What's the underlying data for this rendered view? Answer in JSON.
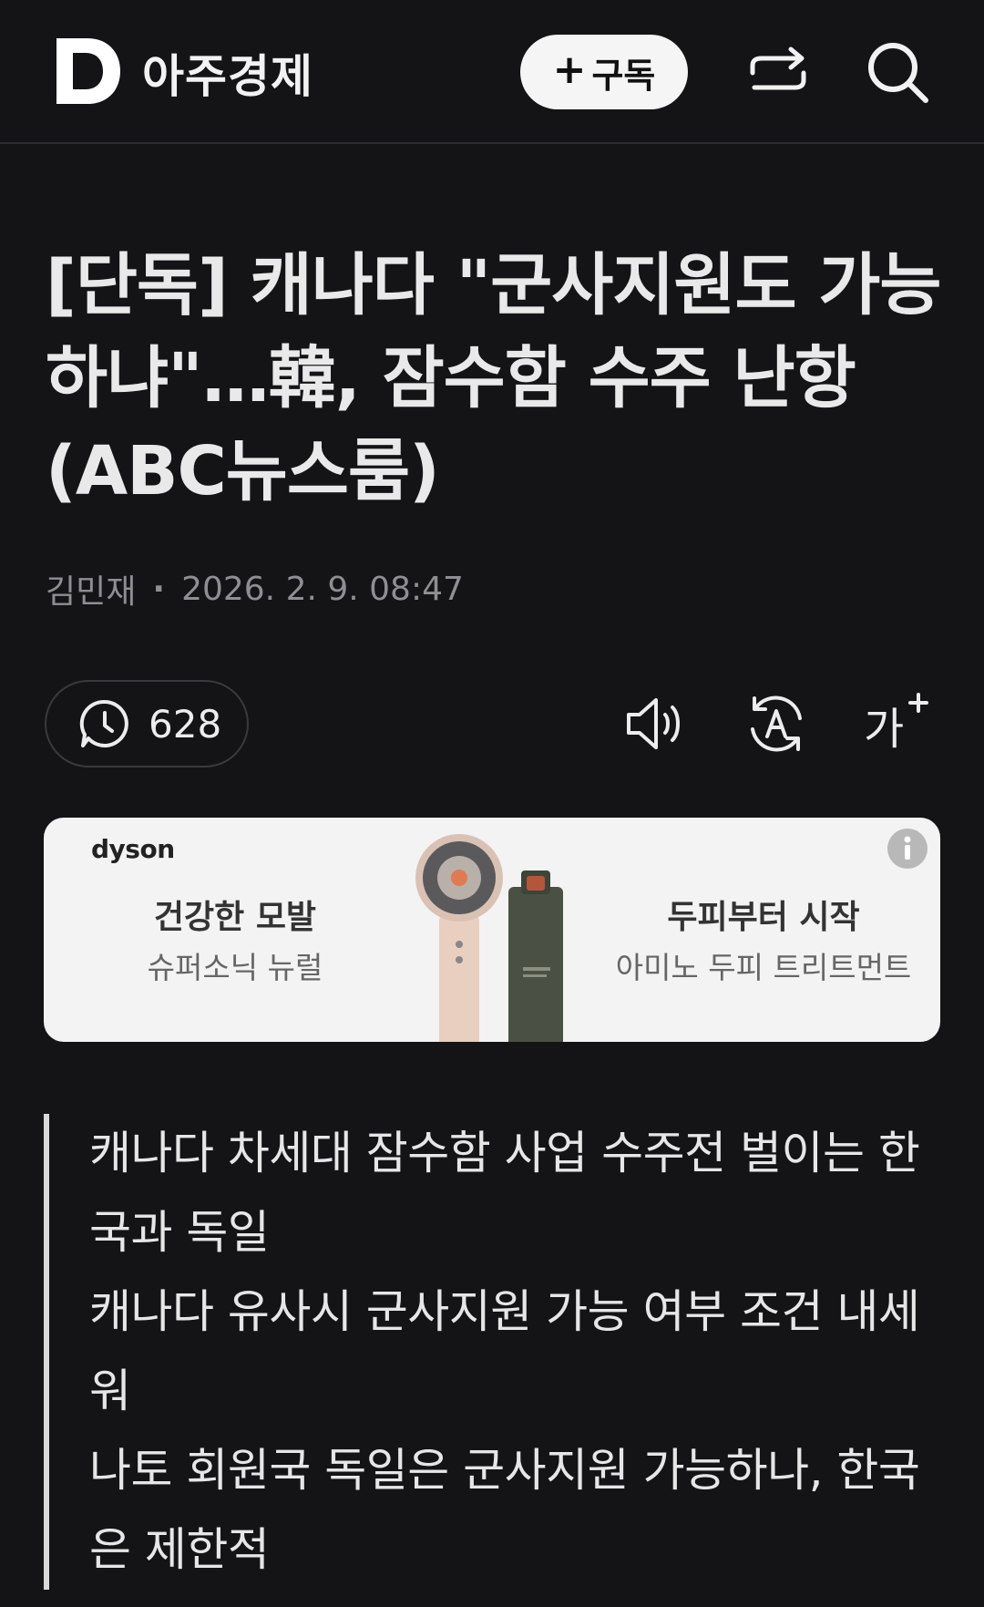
{
  "header": {
    "brand": "아주경제",
    "subscribe_plus": "+",
    "subscribe_label": "구독"
  },
  "article": {
    "title": "[단독] 캐나다 \"군사지원도 가능하냐\"…韓, 잠수함 수주 난항(ABC뉴스룸)",
    "author": "김민재",
    "separator": "·",
    "datetime": "2026. 2. 9. 08:47",
    "view_count": "628",
    "font_size_glyph": "가"
  },
  "ad": {
    "brand": "dyson",
    "left_title": "건강한 모발",
    "left_sub": "슈퍼소닉 뉴럴",
    "right_title": "두피부터 시작",
    "right_sub": "아미노 두피 트리트먼트"
  },
  "summary": [
    "캐나다 차세대 잠수함 사업 수주전 벌이는 한국과 독일",
    "캐나다 유사시 군사지원 가능 여부 조건 내세워",
    "나토 회원국 독일은 군사지원 가능하나, 한국은 제한적"
  ]
}
